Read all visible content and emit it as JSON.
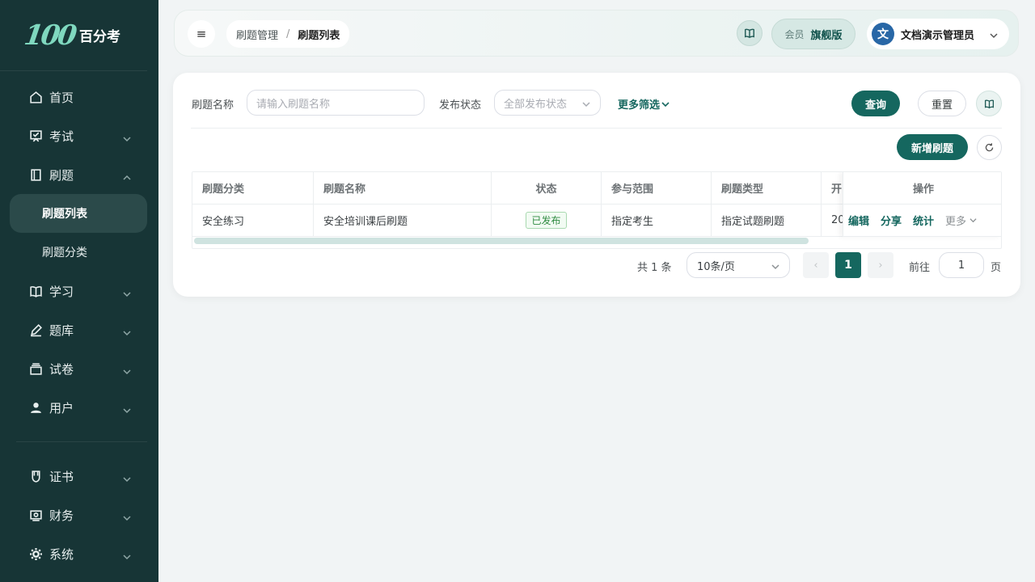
{
  "brand": {
    "logo_mark": "100",
    "name": "百分考"
  },
  "sidebar": {
    "items": [
      {
        "label": "首页",
        "icon": "home-icon"
      },
      {
        "label": "考试",
        "icon": "exam-icon"
      },
      {
        "label": "刷题",
        "icon": "practice-icon"
      },
      {
        "label": "学习",
        "icon": "book-icon"
      },
      {
        "label": "题库",
        "icon": "pen-icon"
      },
      {
        "label": "试卷",
        "icon": "paper-icon"
      },
      {
        "label": "用户",
        "icon": "user-icon"
      },
      {
        "label": "证书",
        "icon": "certificate-icon"
      },
      {
        "label": "财务",
        "icon": "finance-icon"
      },
      {
        "label": "系统",
        "icon": "gear-icon"
      }
    ],
    "sub_items": [
      {
        "label": "刷题列表",
        "active": true
      },
      {
        "label": "刷题分类",
        "active": false
      }
    ]
  },
  "header": {
    "breadcrumb": [
      "刷题管理",
      "刷题列表"
    ],
    "breadcrumb_sep": "/",
    "member_label": "会员",
    "member_tier": "旗舰版",
    "avatar_text": "文",
    "user_name": "文档演示管理员"
  },
  "filters": {
    "name_label": "刷题名称",
    "name_placeholder": "请输入刷题名称",
    "status_label": "发布状态",
    "status_placeholder": "全部发布状态",
    "more_filters": "更多筛选",
    "query_button": "查询",
    "reset_button": "重置"
  },
  "toolbar": {
    "add_button": "新增刷题"
  },
  "table": {
    "columns": [
      "刷题分类",
      "刷题名称",
      "状态",
      "参与范围",
      "刷题类型",
      "开",
      "操作"
    ],
    "rows": [
      {
        "category": "安全练习",
        "name": "安全培训课后刷题",
        "status": "已发布",
        "scope": "指定考生",
        "type": "指定试题刷题",
        "start": "20",
        "actions": [
          "编辑",
          "分享",
          "统计"
        ],
        "more": "更多"
      }
    ]
  },
  "pagination": {
    "total_text": "共 1 条",
    "page_size": "10条/页",
    "prev": "‹",
    "next": "›",
    "current_page": "1",
    "goto_label": "前往",
    "goto_value": "1",
    "page_suffix": "页"
  },
  "colors": {
    "primary": "#15675f",
    "sidebar": "#173536",
    "success": "#2f8b41"
  }
}
